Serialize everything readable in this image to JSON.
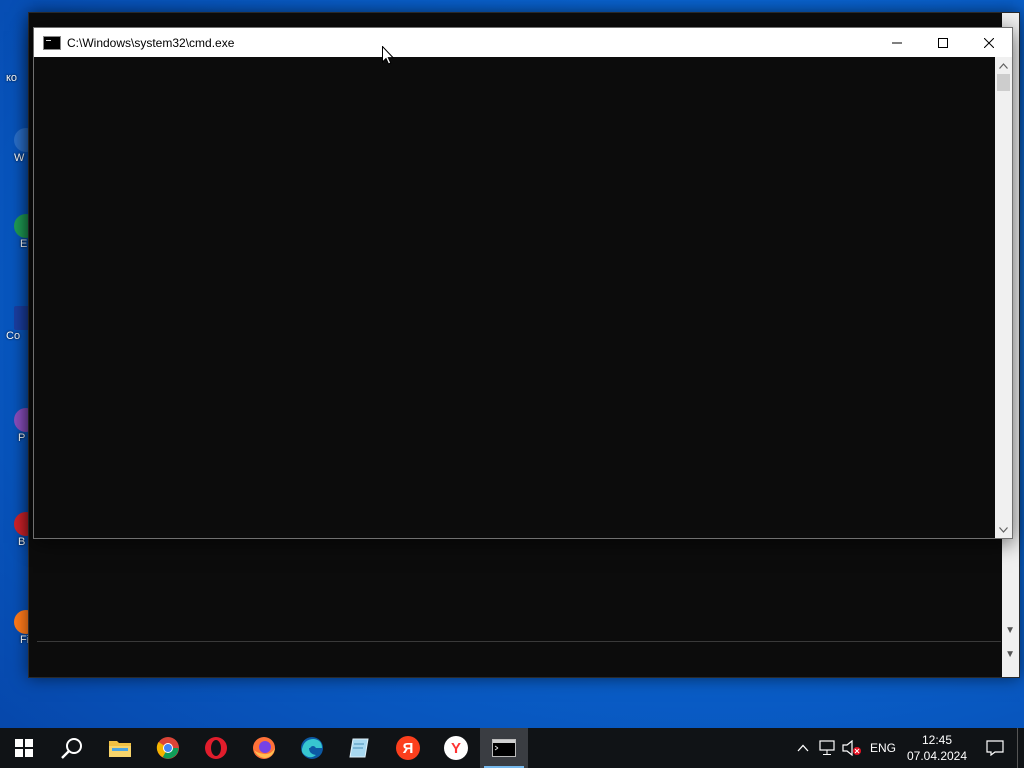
{
  "window": {
    "title": "C:\\Windows\\system32\\cmd.exe",
    "controls": [
      "minimize",
      "maximize",
      "close"
    ]
  },
  "desktop": {
    "icons": [
      {
        "label": "ко",
        "color": "#7aa0c8"
      },
      {
        "label": "W",
        "color": "#2a6fc9"
      },
      {
        "label": "E",
        "color": "#1f9d55"
      },
      {
        "label": "Co",
        "color": "#1b3fa3"
      },
      {
        "label": "P",
        "color": "#8b4fc0"
      },
      {
        "label": "B",
        "color": "#d2232a"
      },
      {
        "label": "Fi",
        "color": "#ff7a1a"
      }
    ]
  },
  "taskbar": {
    "apps": [
      {
        "name": "start",
        "icon": "windows-logo-icon"
      },
      {
        "name": "search",
        "icon": "search-icon"
      },
      {
        "name": "file-explorer",
        "icon": "folder-icon"
      },
      {
        "name": "chrome",
        "icon": "chrome-icon"
      },
      {
        "name": "opera",
        "icon": "opera-icon"
      },
      {
        "name": "firefox",
        "icon": "firefox-icon"
      },
      {
        "name": "edge",
        "icon": "edge-icon"
      },
      {
        "name": "notepad",
        "icon": "notepad-icon"
      },
      {
        "name": "yandex",
        "icon": "yandex-icon",
        "letter": "Я"
      },
      {
        "name": "yandex-browser",
        "icon": "yandex-browser-icon",
        "letter": "Y"
      },
      {
        "name": "cmd",
        "icon": "cmd-icon",
        "active": true
      }
    ],
    "tray": {
      "language": "ENG",
      "time": "12:45",
      "date": "07.04.2024"
    }
  },
  "colors": {
    "console_bg": "#0c0c0c",
    "taskbar_bg": "#101316",
    "accent": "#76b9ed"
  }
}
